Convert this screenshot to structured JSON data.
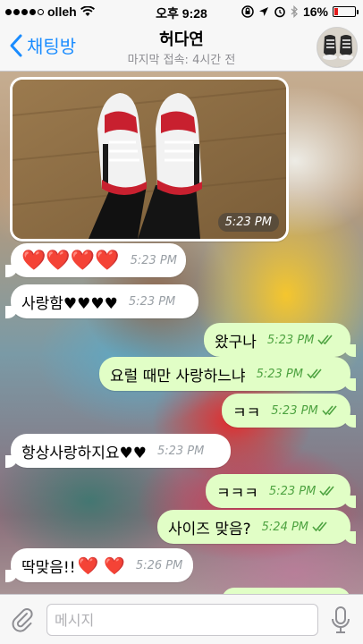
{
  "status_bar": {
    "carrier": "olleh",
    "time": "오후 9:28",
    "battery": "16%",
    "battery_level": 0.16
  },
  "nav": {
    "back_label": "채팅방",
    "title": "허다연",
    "subtitle": "마지막 접속: 4시간 전"
  },
  "messages": [
    {
      "kind": "photo",
      "direction": "in",
      "time": "5:23 PM"
    },
    {
      "kind": "text",
      "direction": "in",
      "text": "",
      "hearts": "❤️❤️❤️❤️",
      "time": "5:23 PM"
    },
    {
      "kind": "text",
      "direction": "in",
      "text": "사랑함♥♥♥♥",
      "time": "5:23 PM"
    },
    {
      "kind": "text",
      "direction": "out",
      "text": "왔구나",
      "time": "5:23 PM",
      "read": true
    },
    {
      "kind": "text",
      "direction": "out",
      "text": "요럴 때만 사랑하느냐",
      "time": "5:23 PM",
      "read": true
    },
    {
      "kind": "text",
      "direction": "out",
      "text": "ㅋㅋ",
      "time": "5:23 PM",
      "read": true
    },
    {
      "kind": "text",
      "direction": "in",
      "text": "항상사랑하지요♥♥",
      "time": "5:23 PM"
    },
    {
      "kind": "text",
      "direction": "out",
      "text": "ㅋㅋㅋ",
      "time": "5:23 PM",
      "read": true
    },
    {
      "kind": "text",
      "direction": "out",
      "text": "사이즈 맞음?",
      "time": "5:24 PM",
      "read": true
    },
    {
      "kind": "text",
      "direction": "in",
      "text": "딱맞음!!",
      "hearts": "❤️ ❤️",
      "time": "5:26 PM"
    }
  ],
  "input": {
    "placeholder": "메시지"
  },
  "colors": {
    "accent": "#1a8cff",
    "incoming_bubble": "#ffffff",
    "outgoing_bubble": "#e1fec6",
    "outgoing_time": "#4ea341",
    "heart": "#e0302f"
  },
  "icons": [
    "signal-dots-icon",
    "wifi-icon",
    "lock-rotation-icon",
    "location-arrow-icon",
    "alarm-icon",
    "bluetooth-icon",
    "battery-icon",
    "chevron-left-icon",
    "double-check-icon",
    "paperclip-icon",
    "microphone-icon"
  ]
}
